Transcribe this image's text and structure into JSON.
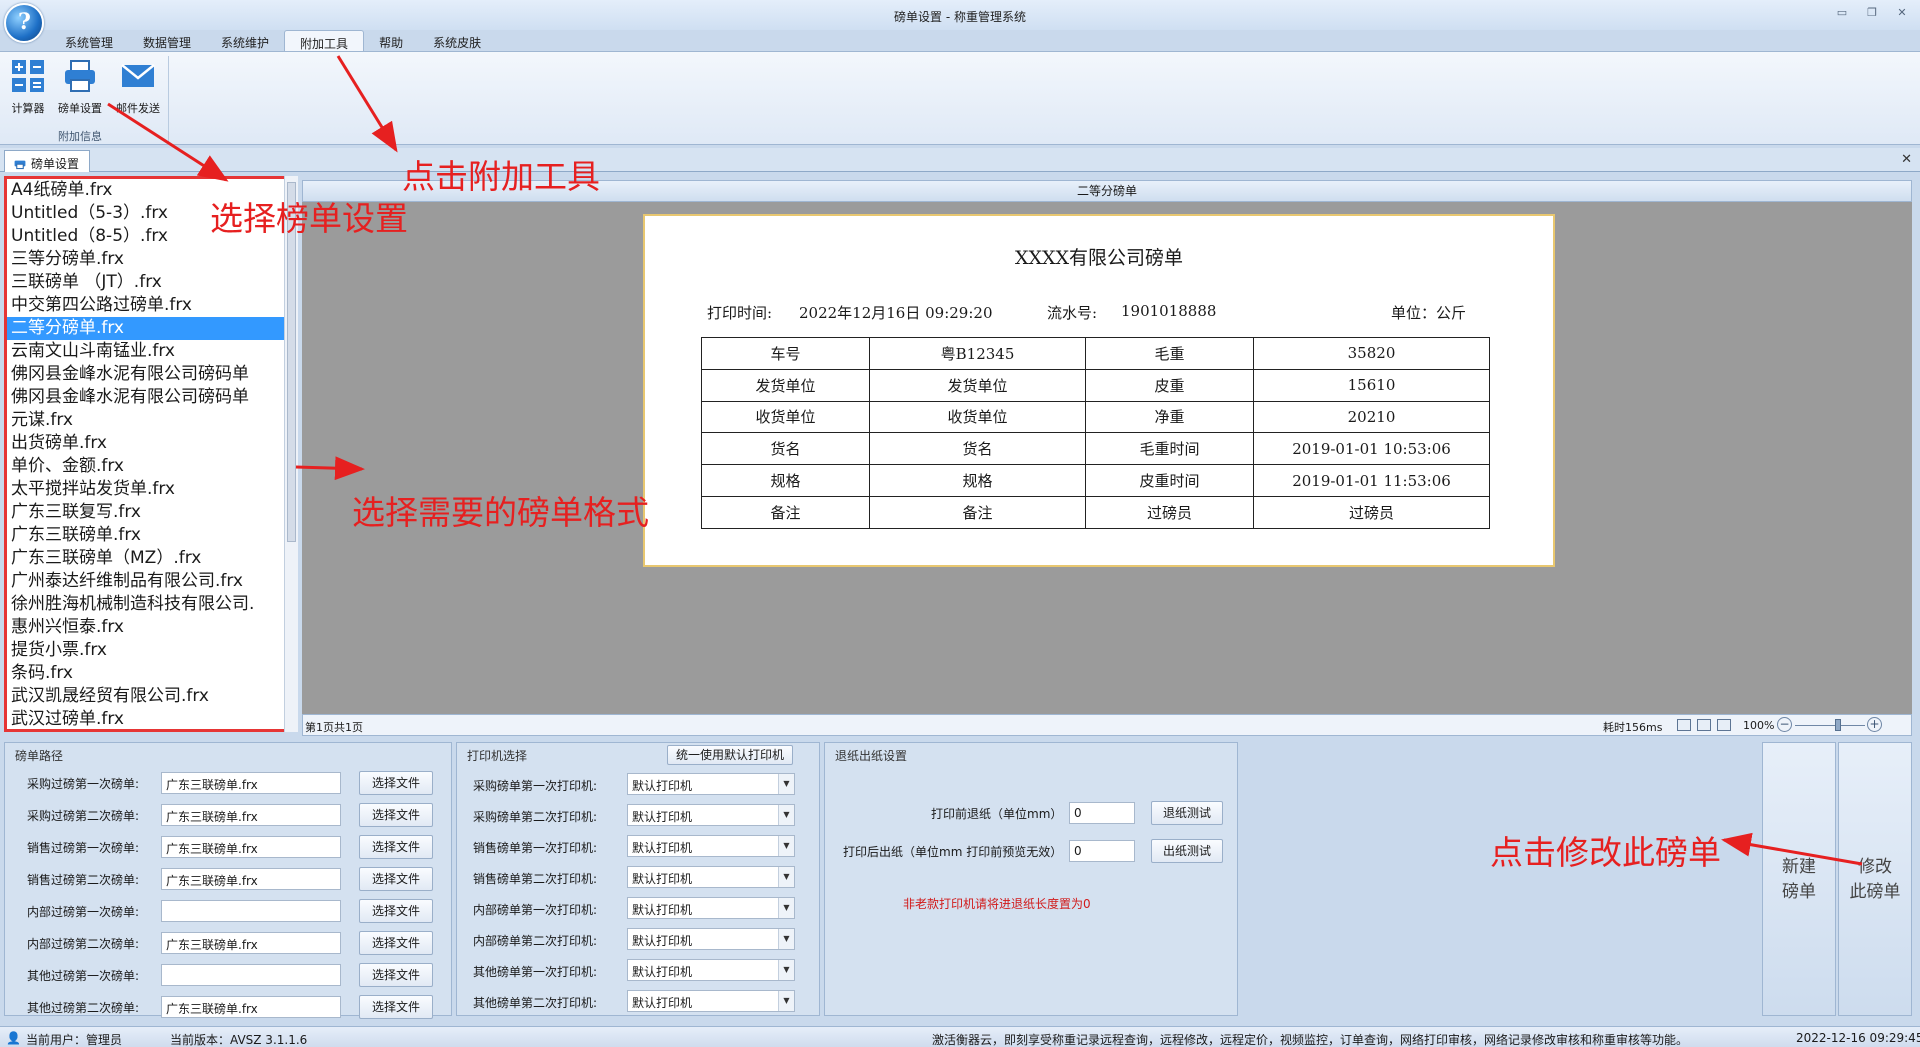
{
  "window": {
    "title": "磅单设置 - 称重管理系统"
  },
  "menu": {
    "tabs": [
      "系统管理",
      "数据管理",
      "系统维护",
      "附加工具",
      "帮助",
      "系统皮肤"
    ],
    "active_index": 3
  },
  "ribbon": {
    "buttons": [
      {
        "label": "计算器",
        "icon": "calculator-icon"
      },
      {
        "label": "磅单设置",
        "icon": "printer-icon"
      },
      {
        "label": "邮件发送",
        "icon": "mail-icon"
      }
    ],
    "group_label": "附加信息"
  },
  "doc_tab": {
    "label": "磅单设置",
    "icon": "printer-icon"
  },
  "report_list": {
    "items": [
      "A4纸磅单.frx",
      "Untitled（5-3）.frx",
      "Untitled（8-5）.frx",
      "三等分磅单.frx",
      "三联磅单 （JT）.frx",
      "中交第四公路过磅单.frx",
      "二等分磅单.frx",
      "云南文山斗南锰业.frx",
      "佛冈县金峰水泥有限公司磅码单",
      "佛冈县金峰水泥有限公司磅码单",
      "元谋.frx",
      "出货磅单.frx",
      "单价、金额.frx",
      "太平搅拌站发货单.frx",
      "广东三联复写.frx",
      "广东三联磅单.frx",
      "广东三联磅单（MZ）.frx",
      "广州泰达纤维制品有限公司.frx",
      "徐州胜海机械制造科技有限公司.",
      "惠州兴恒泰.frx",
      "提货小票.frx",
      "条码.frx",
      "武汉凯晟经贸有限公司.frx",
      "武汉过磅单.frx"
    ],
    "selected_index": 6
  },
  "preview": {
    "header": "二等分磅单",
    "ticket": {
      "title": "XXXX有限公司磅单",
      "print_time_label": "打印时间:",
      "print_time_value": "2022年12月16日 09:29:20",
      "serial_label": "流水号:",
      "serial_value": "1901018888",
      "unit_text": "单位：公斤",
      "rows": [
        [
          "车号",
          "粤B12345",
          "毛重",
          "35820"
        ],
        [
          "发货单位",
          "发货单位",
          "皮重",
          "15610"
        ],
        [
          "收货单位",
          "收货单位",
          "净重",
          "20210"
        ],
        [
          "货名",
          "货名",
          "毛重时间",
          "2019-01-01 10:53:06"
        ],
        [
          "规格",
          "规格",
          "皮重时间",
          "2019-01-01 11:53:06"
        ],
        [
          "备注",
          "备注",
          "过磅员",
          "过磅员"
        ]
      ]
    },
    "status": {
      "page": "第1页共1页",
      "time": "耗时156ms",
      "zoom": "100%"
    }
  },
  "paths": {
    "title": "磅单路径",
    "rows": [
      {
        "label": "采购过磅第一次磅单:",
        "value": "广东三联磅单.frx"
      },
      {
        "label": "采购过磅第二次磅单:",
        "value": "广东三联磅单.frx"
      },
      {
        "label": "销售过磅第一次磅单:",
        "value": "广东三联磅单.frx"
      },
      {
        "label": "销售过磅第二次磅单:",
        "value": "广东三联磅单.frx"
      },
      {
        "label": "内部过磅第一次磅单:",
        "value": ""
      },
      {
        "label": "内部过磅第二次磅单:",
        "value": "广东三联磅单.frx"
      },
      {
        "label": "其他过磅第一次磅单:",
        "value": ""
      },
      {
        "label": "其他过磅第二次磅单:",
        "value": "广东三联磅单.frx"
      }
    ],
    "button_label": "选择文件"
  },
  "printers": {
    "title": "打印机选择",
    "default_button": "统一使用默认打印机",
    "rows": [
      {
        "label": "采购磅单第一次打印机:",
        "value": "默认打印机"
      },
      {
        "label": "采购磅单第二次打印机:",
        "value": "默认打印机"
      },
      {
        "label": "销售磅单第一次打印机:",
        "value": "默认打印机"
      },
      {
        "label": "销售磅单第二次打印机:",
        "value": "默认打印机"
      },
      {
        "label": "内部磅单第一次打印机:",
        "value": "默认打印机"
      },
      {
        "label": "内部磅单第二次打印机:",
        "value": "默认打印机"
      },
      {
        "label": "其他磅单第一次打印机:",
        "value": "默认打印机"
      },
      {
        "label": "其他磅单第二次打印机:",
        "value": "默认打印机"
      }
    ]
  },
  "paper": {
    "title": "退纸出纸设置",
    "retreat_label": "打印前退纸（单位mm）",
    "retreat_value": "0",
    "retreat_button": "退纸测试",
    "feed_label": "打印后出纸（单位mm 打印前预览无效）",
    "feed_value": "0",
    "feed_button": "出纸测试",
    "warning": "非老款打印机请将进退纸长度置为0"
  },
  "actions": {
    "new": [
      "新建",
      "磅单"
    ],
    "edit": [
      "修改",
      "此磅单"
    ]
  },
  "status_bar": {
    "user": "当前用户：管理员",
    "version": "当前版本：AVSZ 3.1.1.6",
    "promo": "激活衡器云，即刻享受称重记录远程查询，远程修改，远程定价，视频监控，订单查询，网络打印审核，网络记录修改审核和称重审核等功能。",
    "datetime": "2022-12-16 09:29:45"
  },
  "annotations": {
    "click_tools": "点击附加工具",
    "choose_setting": "选择榜单设置",
    "choose_format": "选择需要的磅单格式",
    "click_edit": "点击修改此磅单"
  },
  "colors": {
    "annotation": "#e62020",
    "selection": "#3399ff",
    "preview_bg": "#9b9b9b"
  }
}
